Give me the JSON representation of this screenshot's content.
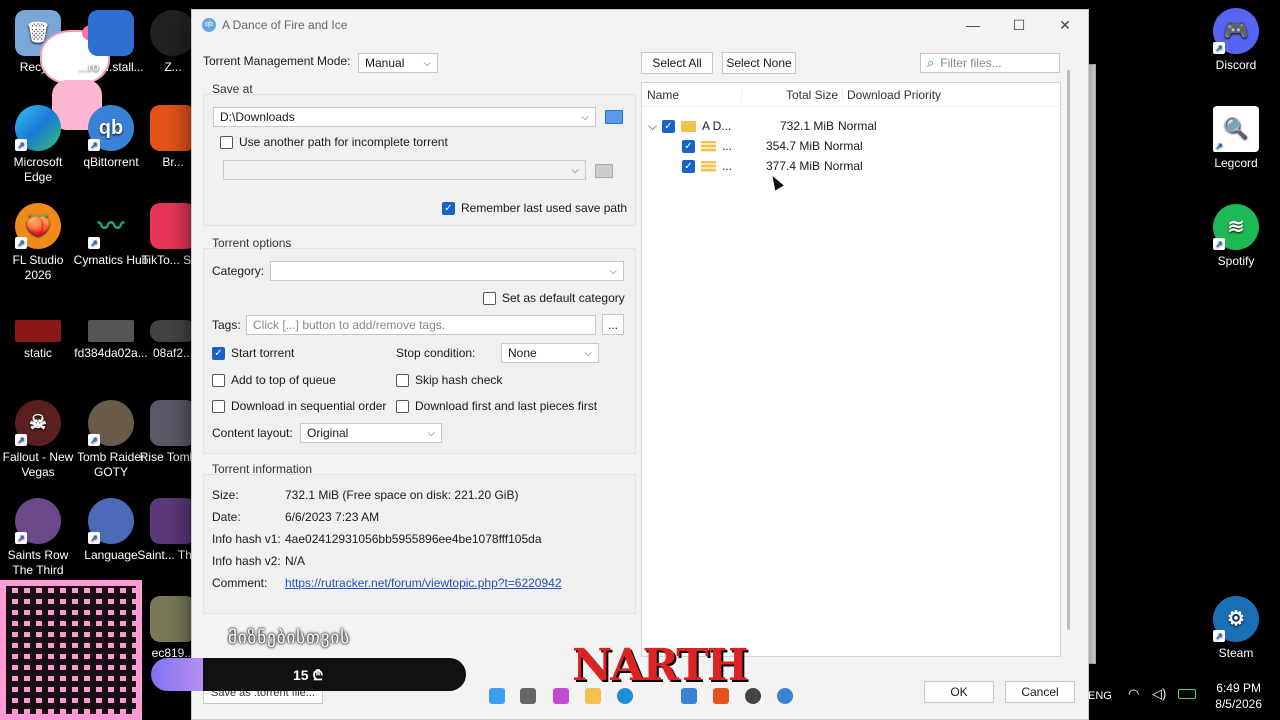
{
  "desktop": {
    "left_icons": [
      {
        "label": "Recy...",
        "color": "#7aa7d8"
      },
      {
        "label": "Microsoft Edge",
        "color": "#1b8fd8"
      },
      {
        "label": "FL Studio 2026",
        "color": "#f18a1d"
      },
      {
        "label": "static",
        "color": "#8a1a1a"
      },
      {
        "label": "Fallout - New Vegas",
        "color": "#5a2020"
      },
      {
        "label": "Saints Row The Third",
        "color": "#6a4a8a"
      }
    ],
    "col2_icons": [
      {
        "label": "...ro ...stall...",
        "color": "#2d6fd0"
      },
      {
        "label": "qBittorrent",
        "color": "#3a82d6"
      },
      {
        "label": "Cymatics Hub",
        "color": "#1aa888"
      },
      {
        "label": "fd384da02a...",
        "color": "#555555"
      },
      {
        "label": "Tomb Raider GOTY",
        "color": "#6a5a4a"
      },
      {
        "label": "Language",
        "color": "#4a6ab8"
      }
    ],
    "col3_icons": [
      {
        "label": "Z...",
        "color": "#222222"
      },
      {
        "label": "Br...",
        "color": "#e5531a"
      },
      {
        "label": "TikTo... St...",
        "color": "#e8355a"
      },
      {
        "label": "08af2...",
        "color": "#444444"
      },
      {
        "label": "Rise Tomb...",
        "color": "#5a5a6a"
      },
      {
        "label": "Saint... The...",
        "color": "#5a3a7a"
      },
      {
        "label": "ec819...",
        "color": "#7a7a5a"
      }
    ],
    "right_icons": [
      {
        "label": "Discord",
        "color": "#5865f2"
      },
      {
        "label": "Legcord",
        "color": "#ffffff"
      },
      {
        "label": "Spotify",
        "color": "#1db954"
      },
      {
        "label": "Steam",
        "color": "#1b6fb5"
      }
    ]
  },
  "dialog": {
    "title": "A Dance of Fire and Ice",
    "controls": {
      "minimize": "—",
      "maximize": "☐",
      "close": "✕"
    },
    "left": {
      "mode_label": "Torrent Management Mode:",
      "mode_value": "Manual",
      "save_at_title": "Save at",
      "save_path": "D:\\Downloads",
      "incomplete_label": "Use another path for incomplete torrent",
      "remember_label": "Remember last used save path",
      "options_title": "Torrent options",
      "category_label": "Category:",
      "category_value": "",
      "default_category_label": "Set as default category",
      "tags_label": "Tags:",
      "tags_placeholder": "Click [...] button to add/remove tags.",
      "tags_button": "...",
      "start_torrent": "Start torrent",
      "stop_condition_label": "Stop condition:",
      "stop_condition_value": "None",
      "add_top_queue": "Add to top of queue",
      "skip_hash": "Skip hash check",
      "sequential": "Download in sequential order",
      "first_last": "Download first and last pieces first",
      "content_layout_label": "Content layout:",
      "content_layout_value": "Original",
      "info_title": "Torrent information",
      "info": {
        "size_label": "Size:",
        "size_value": "732.1 MiB (Free space on disk: 221.20 GiB)",
        "date_label": "Date:",
        "date_value": "6/6/2023 7:23 AM",
        "hash1_label": "Info hash v1:",
        "hash1_value": "4ae02412931056bb5955896ee4be1078fff105da",
        "hash2_label": "Info hash v2:",
        "hash2_value": "N/A",
        "comment_label": "Comment:",
        "comment_value": "https://rutracker.net/forum/viewtopic.php?t=6220942"
      },
      "save_torrent_button": "Save as .torrent file..."
    },
    "right": {
      "select_all": "Select All",
      "select_none": "Select None",
      "filter_placeholder": "Filter files...",
      "columns": {
        "name": "Name",
        "total_size": "Total Size",
        "priority": "Download Priority"
      },
      "rows": [
        {
          "name": "A D...",
          "size": "732.1 MiB",
          "priority": "Normal"
        },
        {
          "name": "...",
          "size": "354.7 MiB",
          "priority": "Normal"
        },
        {
          "name": "...",
          "size": "377.4 MiB",
          "priority": "Normal"
        }
      ]
    },
    "ok_button": "OK",
    "cancel_button": "Cancel"
  },
  "overlay": {
    "georgian_text": "მიზნებისთვის",
    "donation_amount": "15 ₾",
    "brand_text": "NARTH"
  },
  "taskbar": {
    "lang": "ENG",
    "time": "6:49 PM",
    "date": "8/5/2026"
  }
}
